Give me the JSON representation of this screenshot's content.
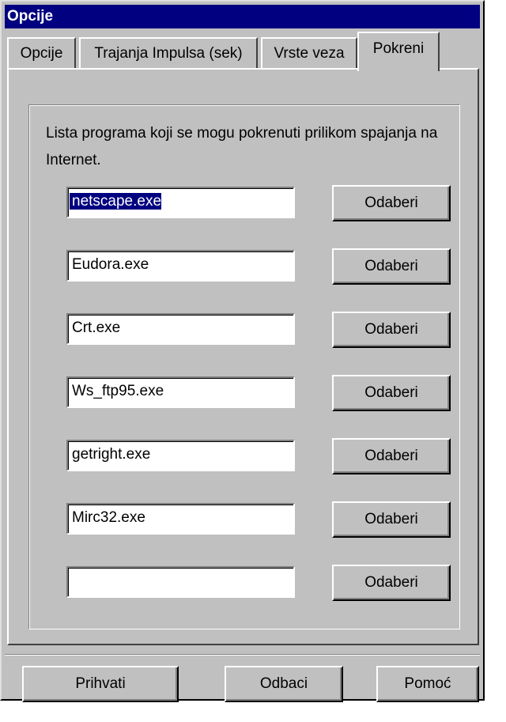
{
  "window": {
    "title": "Opcije"
  },
  "tabs": [
    {
      "label": "Opcije",
      "active": false
    },
    {
      "label": "Trajanja Impulsa (sek)",
      "active": false
    },
    {
      "label": "Vrste veza",
      "active": false
    },
    {
      "label": "Pokreni",
      "active": true
    }
  ],
  "panel": {
    "description": "Lista programa koji se mogu pokrenuti prilikom spajanja na Internet.",
    "programs": [
      {
        "value": "netscape.exe",
        "selected": true
      },
      {
        "value": "Eudora.exe"
      },
      {
        "value": "Crt.exe"
      },
      {
        "value": "Ws_ftp95.exe"
      },
      {
        "value": "getright.exe"
      },
      {
        "value": "Mirc32.exe"
      },
      {
        "value": ""
      }
    ],
    "browse_label": "Odaberi"
  },
  "buttons": {
    "accept": "Prihvati",
    "cancel": "Odbaci",
    "help": "Pomoć"
  },
  "colors": {
    "title_bar": "#000080",
    "face": "#c0c0c0",
    "selection": "#000080"
  }
}
